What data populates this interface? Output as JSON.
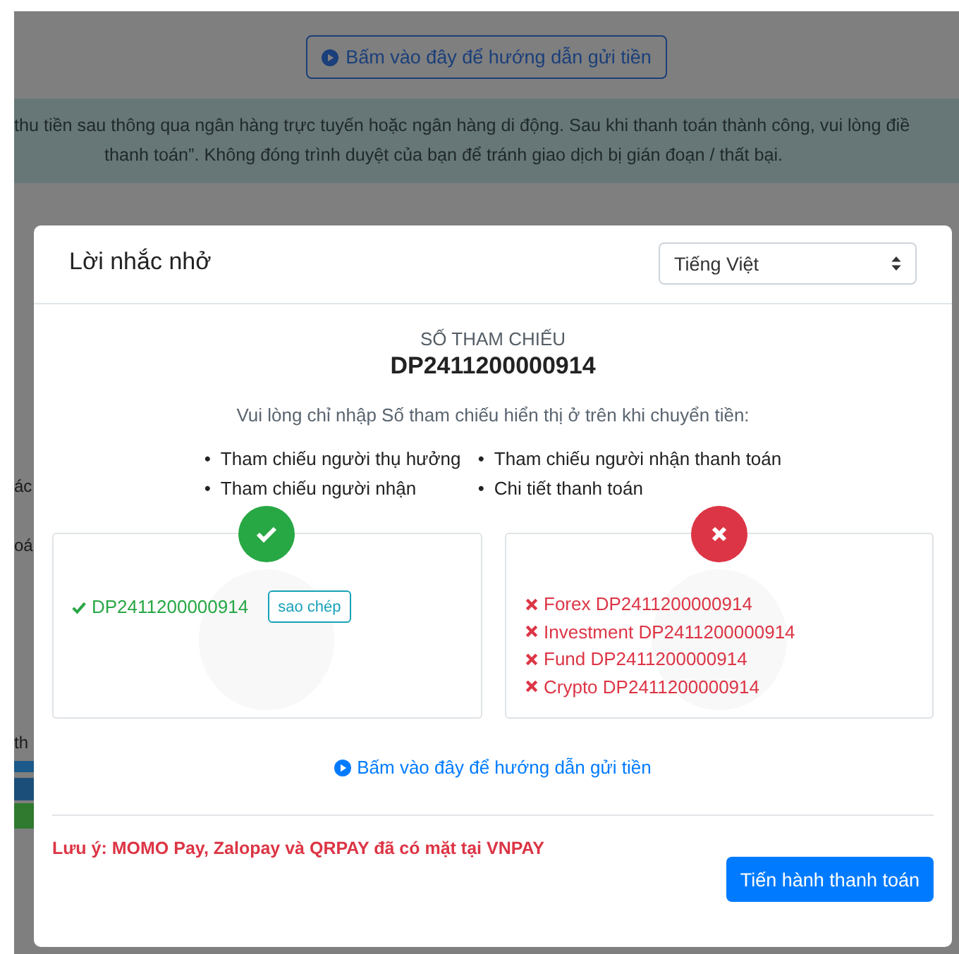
{
  "page": {
    "guide_button": "Bấm vào đây để hướng dẫn gửi tiền",
    "notice_lines": [
      "thu tiền sau thông qua ngân hàng trực tuyến hoặc ngân hàng di động. Sau khi thanh toán thành công, vui lòng điề",
      "thanh toán”. Không đóng trình duyệt của bạn để tránh giao dịch bị gián đoạn / thất bại."
    ],
    "side_fragments": [
      "ác",
      "oá",
      "th"
    ]
  },
  "modal": {
    "title": "Lời nhắc nhở",
    "language": "Tiếng Việt",
    "reference_label": "SỐ THAM CHIẾU",
    "reference": "DP2411200000914",
    "instruction": "Vui lòng chỉ nhập Số tham chiếu hiển thị ở trên khi chuyển tiền:",
    "bullet": "•",
    "fields": [
      [
        "Tham chiếu người thụ hưởng",
        "Tham chiếu người nhận"
      ],
      [
        "Tham chiếu người nhận thanh toán",
        "Chi tiết thanh toán"
      ]
    ],
    "examples": [
      {
        "kind": "correct",
        "items": [
          "DP2411200000914"
        ],
        "copy_button": "sao chép"
      },
      {
        "kind": "wrong",
        "items": [
          "Forex DP2411200000914",
          "Investment DP2411200000914",
          "Fund DP2411200000914",
          "Crypto DP2411200000914"
        ]
      }
    ],
    "guide_link": "Bấm vào đây để hướng dẫn gửi tiền",
    "note": "Lưu ý: MOMO Pay, Zalopay và QRPAY đã có mặt tại VNPAY",
    "submit_button": "Tiến hành thanh toán"
  }
}
